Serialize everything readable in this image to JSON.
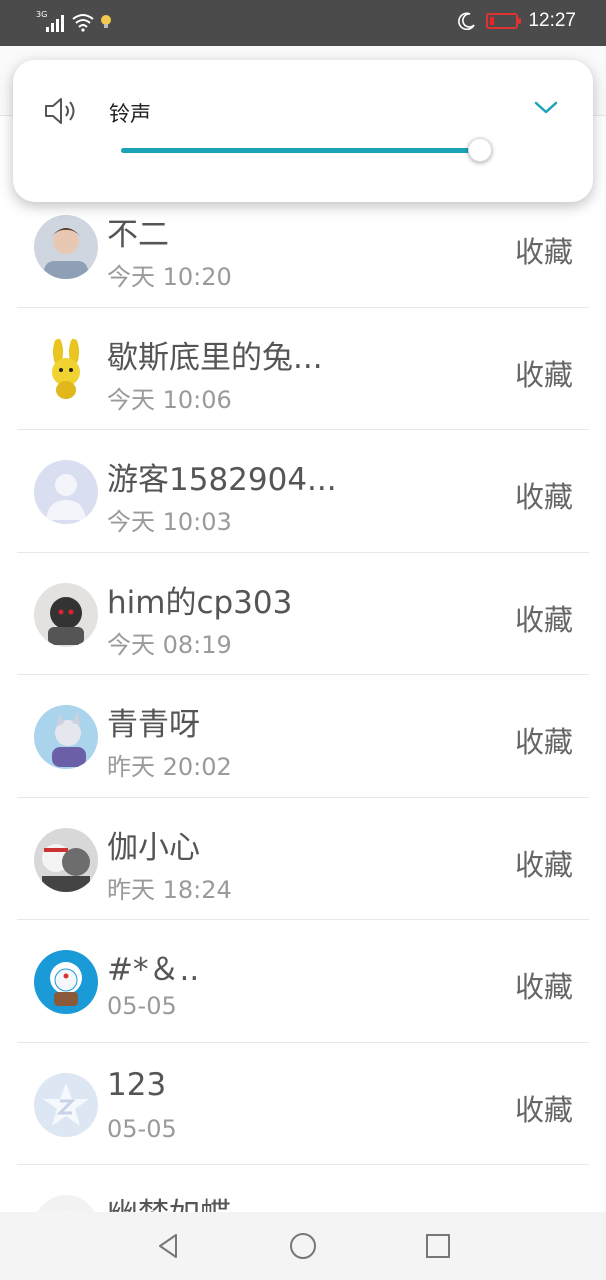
{
  "status_bar": {
    "network": "3G",
    "time": "12:27",
    "icons": [
      "signal-icon",
      "wifi-icon",
      "bulb-icon",
      "moon-icon",
      "battery-icon"
    ],
    "battery_color": "#dd2222"
  },
  "volume_panel": {
    "label": "铃声",
    "level": 0.97,
    "accent": "#1aa3b5"
  },
  "list": {
    "items": [
      {
        "name": "不二",
        "time": "今天 10:20",
        "action": "收藏"
      },
      {
        "name": "歇斯底里的兔...",
        "time": "今天 10:06",
        "action": "收藏"
      },
      {
        "name": "游客1582904...",
        "time": "今天 10:03",
        "action": "收藏"
      },
      {
        "name": "him的cp303",
        "time": "今天 08:19",
        "action": "收藏"
      },
      {
        "name": "青青呀",
        "time": "昨天 20:02",
        "action": "收藏"
      },
      {
        "name": "伽小心",
        "time": "昨天 18:24",
        "action": "收藏"
      },
      {
        "name": "#*＆..",
        "time": "05-05",
        "action": "收藏"
      },
      {
        "name": "123",
        "time": "05-05",
        "action": "收藏"
      },
      {
        "name": "幽梦如蝶",
        "time": "",
        "action": ""
      }
    ]
  },
  "nav_bar": {
    "buttons": [
      "back-icon",
      "home-icon",
      "recents-icon"
    ]
  }
}
